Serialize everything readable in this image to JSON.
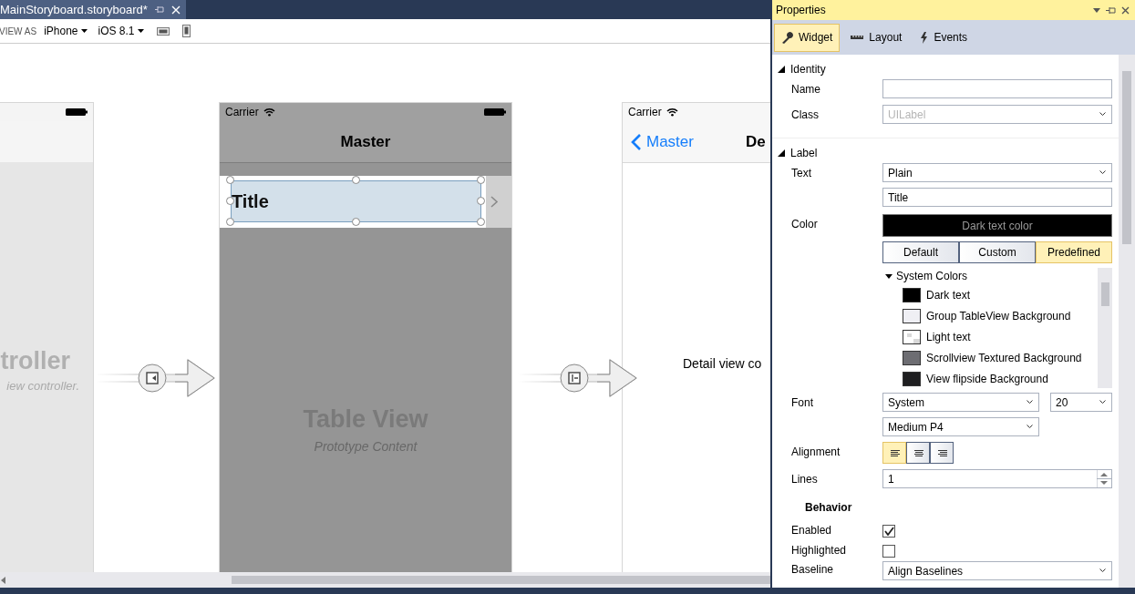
{
  "document_tab": {
    "title": "MainStoryboard.storyboard*",
    "selected": true
  },
  "toolbar": {
    "label": "VIEW AS",
    "device": "iPhone",
    "os": "iOS 8.1"
  },
  "canvas": {
    "scenes": [
      {
        "kind": "plain",
        "title": "troller",
        "subtitle": "iew controller."
      },
      {
        "kind": "table",
        "carrier": "Carrier",
        "nav_title": "Master",
        "cell_title": "Title",
        "cell_selected": true,
        "title": "Table View",
        "subtitle": "Prototype Content"
      },
      {
        "kind": "detail",
        "carrier": "Carrier",
        "back": "Master",
        "nav_title": "De",
        "body": "Detail view co"
      }
    ]
  },
  "properties": {
    "title": "Properties",
    "tabs": [
      {
        "label": "Widget",
        "selected": true
      },
      {
        "label": "Layout",
        "selected": false
      },
      {
        "label": "Events",
        "selected": false
      }
    ],
    "identity": {
      "heading": "Identity",
      "expanded": true,
      "name_label": "Name",
      "class_label": "Class",
      "class_placeholder": "UILabel"
    },
    "label": {
      "heading": "Label",
      "expanded": true,
      "text_label": "Text",
      "text_mode": "Plain",
      "text_value": "Title",
      "color_label": "Color",
      "color_value": "Dark text color",
      "color_modes": [
        {
          "label": "Default",
          "selected": false
        },
        {
          "label": "Custom",
          "selected": false
        },
        {
          "label": "Predefined",
          "selected": true
        }
      ],
      "color_group": {
        "label": "System Colors",
        "expanded": true,
        "items": [
          {
            "label": "Dark text",
            "kind": "solid",
            "color": "#000000"
          },
          {
            "label": "Group TableView Background",
            "kind": "solid",
            "color": "#efeff4"
          },
          {
            "label": "Light text",
            "kind": "pattern",
            "color": "#ffffff"
          },
          {
            "label": "Scrollview Textured Background",
            "kind": "solid",
            "color": "#6d6d72"
          },
          {
            "label": "View flipside Background",
            "kind": "solid",
            "color": "#1f1f21"
          }
        ]
      },
      "font_label": "Font",
      "font_family": "System",
      "font_size": "20",
      "font_style": "Medium P4",
      "alignment_label": "Alignment",
      "alignments": [
        {
          "kind": "left",
          "selected": true
        },
        {
          "kind": "center",
          "selected": false
        },
        {
          "kind": "right",
          "selected": false
        }
      ],
      "lines_label": "Lines",
      "lines_value": "1"
    },
    "behavior": {
      "heading": "Behavior",
      "options": [
        {
          "label": "Enabled",
          "checked": true
        },
        {
          "label": "Highlighted",
          "checked": false
        }
      ],
      "baseline_label": "Baseline",
      "baseline_value": "Align Baselines"
    }
  }
}
